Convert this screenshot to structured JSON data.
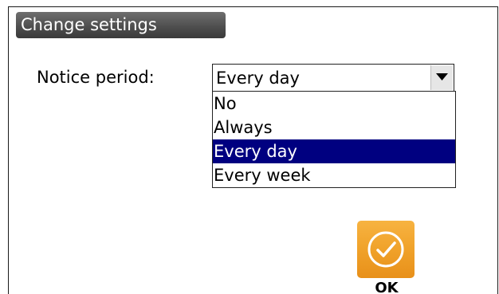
{
  "dialog": {
    "title": "Change settings"
  },
  "notice_period": {
    "label": "Notice period:",
    "selected_value": "Every day",
    "options": [
      {
        "label": "No",
        "selected": false
      },
      {
        "label": "Always",
        "selected": false
      },
      {
        "label": "Every day",
        "selected": true
      },
      {
        "label": "Every week",
        "selected": false
      }
    ]
  },
  "ok_button": {
    "label": "OK",
    "icon": "checkmark-circle-icon",
    "color": "#f0a22a"
  },
  "colors": {
    "title_bar": "#555555",
    "selection_highlight": "#000080"
  }
}
